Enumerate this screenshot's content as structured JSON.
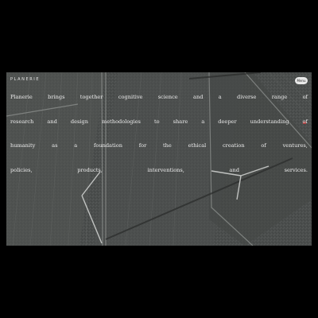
{
  "header": {
    "logo_text": "PLANERIE",
    "menu_label": "Menu"
  },
  "main": {
    "paragraph_lines": [
      [
        "Planerie",
        "brings",
        "together",
        "cognitive",
        "science",
        "and",
        "a",
        "diverse",
        "range",
        "of"
      ],
      [
        "research",
        "and",
        "design",
        "methodologies",
        "to",
        "share",
        "a",
        "deeper",
        "understanding",
        "of"
      ],
      [
        "humanity",
        "as",
        "a",
        "foundation",
        "for",
        "the",
        "ethical",
        "creation",
        "of",
        "ventures,"
      ],
      [
        "policies,",
        "products,",
        "interventions,",
        "and",
        "services."
      ]
    ]
  },
  "colors": {
    "page_background": "#000000",
    "hero_tint": "#4a4d4c",
    "text": "#ececec",
    "menu_button": "#e9e9e9"
  },
  "icons": [
    "aerial-wind-farm-image"
  ]
}
